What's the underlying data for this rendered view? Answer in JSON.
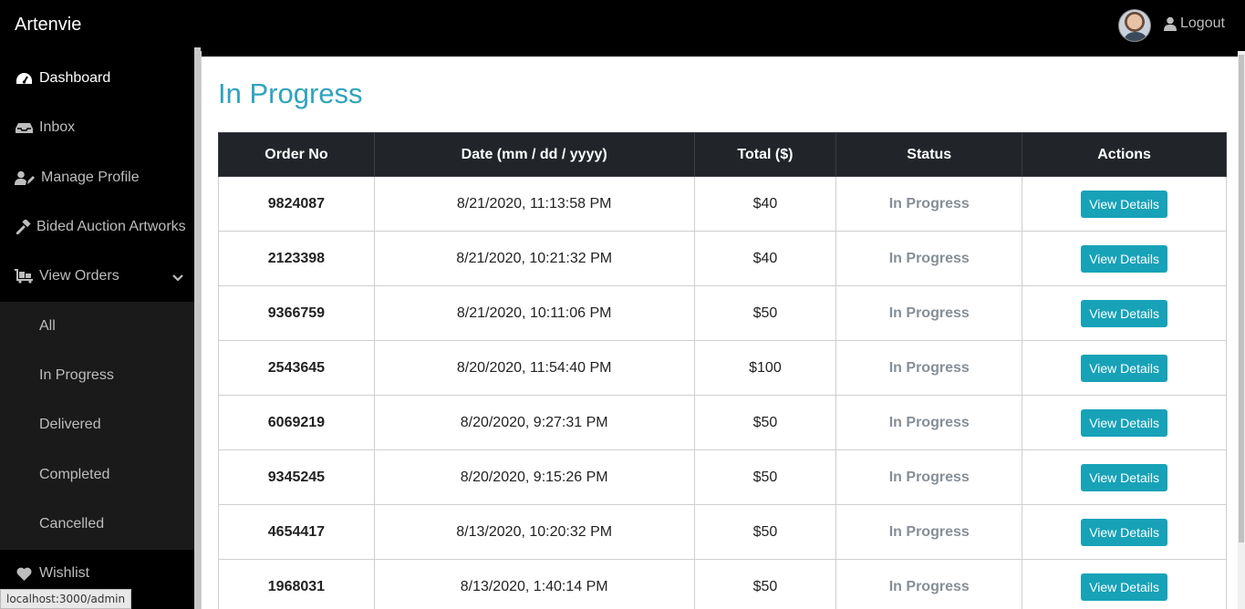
{
  "app": {
    "brand": "Artenvie",
    "logout_label": "Logout"
  },
  "sidebar": {
    "items": [
      {
        "label": "Dashboard",
        "icon": "dashboard-icon"
      },
      {
        "label": "Inbox",
        "icon": "inbox-icon"
      },
      {
        "label": "Manage Profile",
        "icon": "user-edit-icon"
      },
      {
        "label": "Bided Auction Artworks",
        "icon": "gavel-icon"
      },
      {
        "label": "View Orders",
        "icon": "cart-icon"
      }
    ],
    "sub_items": [
      "All",
      "In Progress",
      "Delivered",
      "Completed",
      "Cancelled"
    ],
    "wishlist": "Wishlist"
  },
  "page": {
    "title": "In Progress"
  },
  "table": {
    "headers": [
      "Order No",
      "Date (mm / dd / yyyy)",
      "Total ($)",
      "Status",
      "Actions"
    ],
    "rows": [
      {
        "order": "9824087",
        "date": "8/21/2020, 11:13:58 PM",
        "total": "$40",
        "status": "In Progress",
        "action": "View Details"
      },
      {
        "order": "2123398",
        "date": "8/21/2020, 10:21:32 PM",
        "total": "$40",
        "status": "In Progress",
        "action": "View Details"
      },
      {
        "order": "9366759",
        "date": "8/21/2020, 10:11:06 PM",
        "total": "$50",
        "status": "In Progress",
        "action": "View Details"
      },
      {
        "order": "2543645",
        "date": "8/20/2020, 11:54:40 PM",
        "total": "$100",
        "status": "In Progress",
        "action": "View Details"
      },
      {
        "order": "6069219",
        "date": "8/20/2020, 9:27:31 PM",
        "total": "$50",
        "status": "In Progress",
        "action": "View Details"
      },
      {
        "order": "9345245",
        "date": "8/20/2020, 9:15:26 PM",
        "total": "$50",
        "status": "In Progress",
        "action": "View Details"
      },
      {
        "order": "4654417",
        "date": "8/13/2020, 10:20:32 PM",
        "total": "$50",
        "status": "In Progress",
        "action": "View Details"
      },
      {
        "order": "1968031",
        "date": "8/13/2020, 1:40:14 PM",
        "total": "$50",
        "status": "In Progress",
        "action": "View Details"
      }
    ]
  },
  "statusbar": {
    "url": "localhost:3000/admin"
  },
  "colors": {
    "accent": "#2fa3bd",
    "button": "#17a2b8",
    "header_bg": "#212529"
  }
}
